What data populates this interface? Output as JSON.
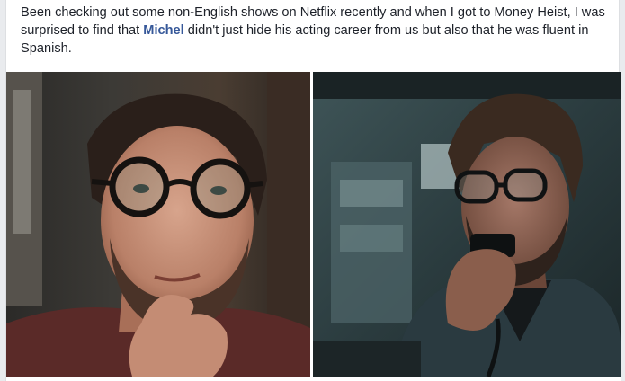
{
  "post": {
    "text_before": "Been checking out some non-English shows on Netflix recently and when I got to Money Heist, I was surprised to find that ",
    "mention": "Michel",
    "text_after": " didn't just hide his acting career from us but also that he was fluent in Spanish."
  },
  "photos": [
    {
      "subject": "man-with-glasses-portrait"
    },
    {
      "subject": "man-in-suit-with-radio"
    }
  ],
  "colors": {
    "text": "#1d2129",
    "mention": "#365899",
    "background": "#ffffff"
  }
}
